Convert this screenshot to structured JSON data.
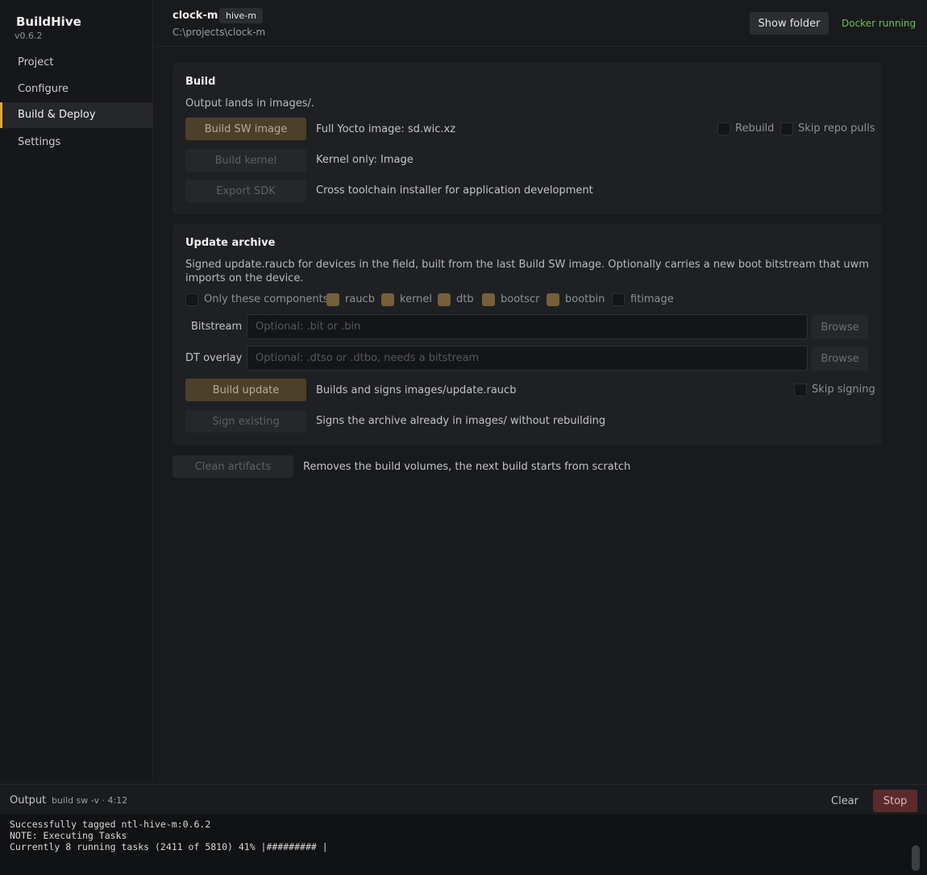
{
  "app": {
    "name": "BuildHive",
    "version": "v0.6.2"
  },
  "sidebar": {
    "items": [
      {
        "label": "Project"
      },
      {
        "label": "Configure"
      },
      {
        "label": "Build & Deploy"
      },
      {
        "label": "Settings"
      }
    ],
    "active": "Build & Deploy"
  },
  "header": {
    "project_name": "clock-m",
    "tag": "hive-m",
    "path": "C:\\projects\\clock-m",
    "show_folder_label": "Show folder",
    "status": "Docker running",
    "status_color": "#6fbf5a"
  },
  "build": {
    "title": "Build",
    "description": "Output lands in images/.",
    "actions": [
      {
        "label": "Build SW image",
        "desc": "Full Yocto image: sd.wic.xz"
      },
      {
        "label": "Build kernel",
        "desc": "Kernel only: Image"
      },
      {
        "label": "Export SDK",
        "desc": "Cross toolchain installer for application development"
      }
    ],
    "options": [
      {
        "label": "Rebuild",
        "checked": false
      },
      {
        "label": "Skip repo pulls",
        "checked": false
      }
    ]
  },
  "update": {
    "title": "Update archive",
    "description": "Signed update.raucb for devices in the field, built from the last Build SW image. Optionally carries a new boot bitstream that uwm imports on the device.",
    "only_components_label": "Only these components:",
    "components": [
      {
        "label": "raucb",
        "checked": true
      },
      {
        "label": "kernel",
        "checked": true
      },
      {
        "label": "dtb",
        "checked": true
      },
      {
        "label": "bootscr",
        "checked": true
      },
      {
        "label": "bootbin",
        "checked": true
      },
      {
        "label": "fitimage",
        "checked": false
      }
    ],
    "bitstream": {
      "label": "Bitstream",
      "placeholder": "Optional: .bit or .bin",
      "browse": "Browse"
    },
    "overlay": {
      "label": "DT overlay",
      "placeholder": "Optional: .dtso or .dtbo, needs a bitstream",
      "browse": "Browse"
    },
    "actions": [
      {
        "label": "Build update",
        "desc": "Builds and signs images/update.raucb"
      },
      {
        "label": "Sign existing",
        "desc": "Signs the archive already in images/ without rebuilding"
      }
    ],
    "skip_signing": "Skip signing"
  },
  "clean": {
    "label": "Clean artifacts",
    "desc": "Removes the build volumes, the next build starts from scratch"
  },
  "output": {
    "title": "Output",
    "command": "build sw -v  ·  4:12",
    "clear_label": "Clear",
    "stop_label": "Stop",
    "lines": [
      "Successfully tagged ntl-hive-m:0.6.2",
      "NOTE: Executing Tasks",
      "Currently 8 running tasks (2411 of 5810) 41% |######### |"
    ]
  },
  "colors": {
    "accent": "#e3a53d",
    "stop": "#5a2a2d"
  }
}
